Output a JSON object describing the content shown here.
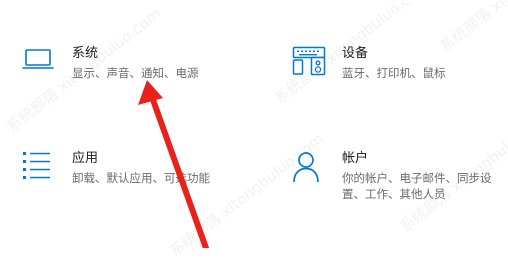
{
  "accent_color": "#0078d7",
  "annotation_color": "#e8221b",
  "tiles": [
    {
      "title": "系统",
      "desc": "显示、声音、通知、电源",
      "icon": "laptop-icon"
    },
    {
      "title": "设备",
      "desc": "蓝牙、打印机、鼠标",
      "icon": "keyboard-speaker-icon"
    },
    {
      "title": "应用",
      "desc": "卸载、默认应用、可选功能",
      "icon": "apps-list-icon"
    },
    {
      "title": "帐户",
      "desc": "你的帐户、电子邮件、同步设置、工作、其他人员",
      "icon": "person-icon"
    }
  ],
  "watermark": "系统部落 xitongbuluo.com"
}
